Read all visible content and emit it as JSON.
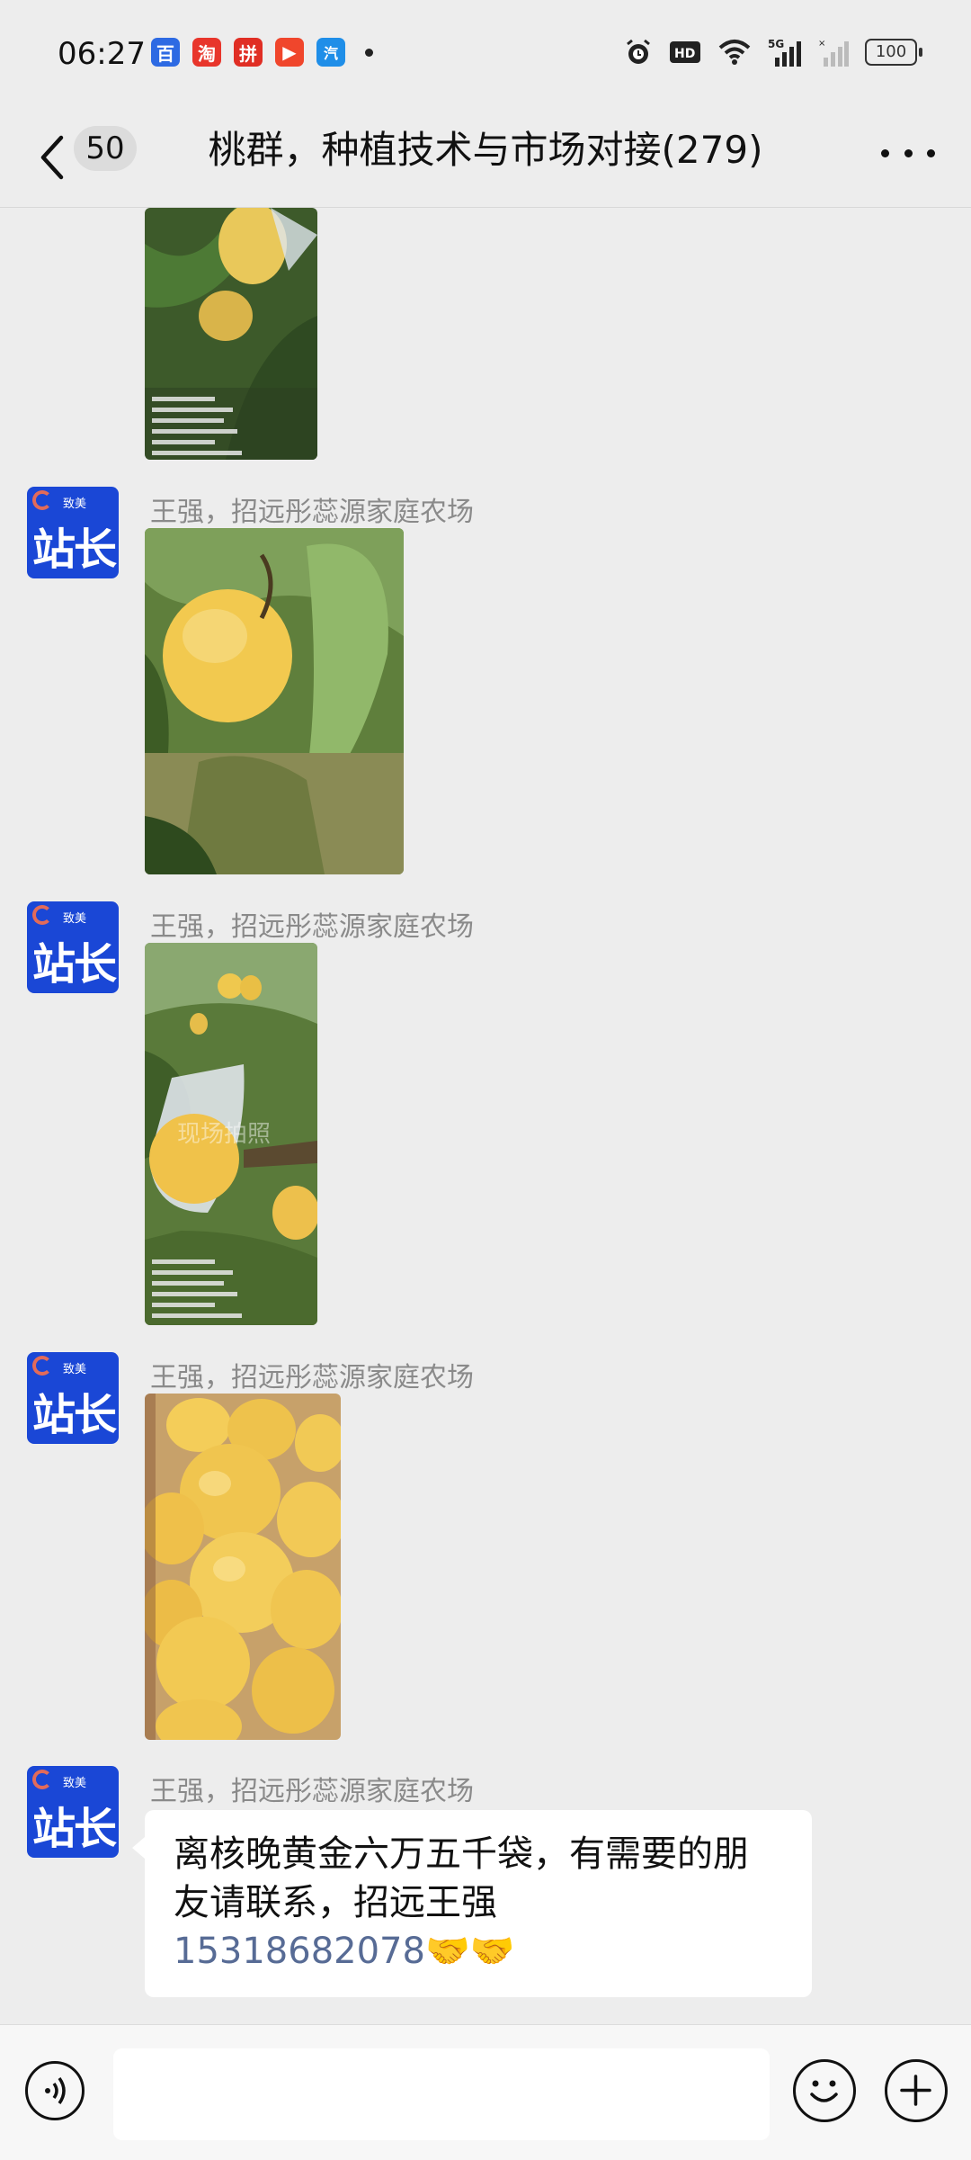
{
  "status_bar": {
    "time": "06:27",
    "apps": [
      {
        "name": "baidu-app-icon",
        "glyph": "百",
        "color": "#2d6ae3"
      },
      {
        "name": "taobao-app-icon",
        "glyph": "淘",
        "color": "#e8352b"
      },
      {
        "name": "pinduoduo-app-icon",
        "glyph": "拼",
        "color": "#e02e24"
      },
      {
        "name": "video-app-icon",
        "glyph": "▶",
        "color": "#f0462c"
      },
      {
        "name": "blue-app-icon",
        "glyph": "汽",
        "color": "#1f8ee8"
      }
    ],
    "network": "5G",
    "battery": "100"
  },
  "nav": {
    "unread_count": "50",
    "title": "桃群，种植技术与市场对接(279)"
  },
  "avatar": {
    "main_text": "站长",
    "small_text": "致美",
    "color": "#1a47d6"
  },
  "messages": [
    {
      "type": "image",
      "sender": "",
      "image": "peaches-on-branch-tagged"
    },
    {
      "type": "image",
      "sender": "王强，招远彤蕊源家庭农场",
      "image": "single-peach-on-tree"
    },
    {
      "type": "image",
      "sender": "王强，招远彤蕊源家庭农场",
      "image": "bagged-peach-on-tree"
    },
    {
      "type": "image",
      "sender": "王强，招远彤蕊源家庭农场",
      "image": "pile-of-yellow-peaches"
    },
    {
      "type": "text",
      "sender": "王强，招远彤蕊源家庭农场",
      "text": "离核晚黄金六万五千袋，有需要的朋友请联系，招远王强",
      "phone": "15318682078",
      "emoji": "🤝🤝"
    }
  ],
  "photo_watermark": "现场拍照",
  "colors": {
    "background": "#ededed",
    "link": "#576b95",
    "bubble": "#ffffff"
  }
}
